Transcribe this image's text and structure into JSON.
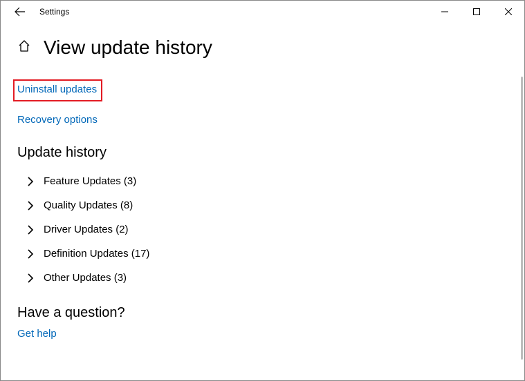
{
  "titlebar": {
    "title": "Settings"
  },
  "page": {
    "title": "View update history"
  },
  "links": {
    "uninstall": "Uninstall updates",
    "recovery": "Recovery options",
    "get_help": "Get help"
  },
  "sections": {
    "history_heading": "Update history",
    "question_heading": "Have a question?"
  },
  "categories": [
    {
      "label": "Feature Updates (3)"
    },
    {
      "label": "Quality Updates (8)"
    },
    {
      "label": "Driver Updates (2)"
    },
    {
      "label": "Definition Updates (17)"
    },
    {
      "label": "Other Updates (3)"
    }
  ]
}
